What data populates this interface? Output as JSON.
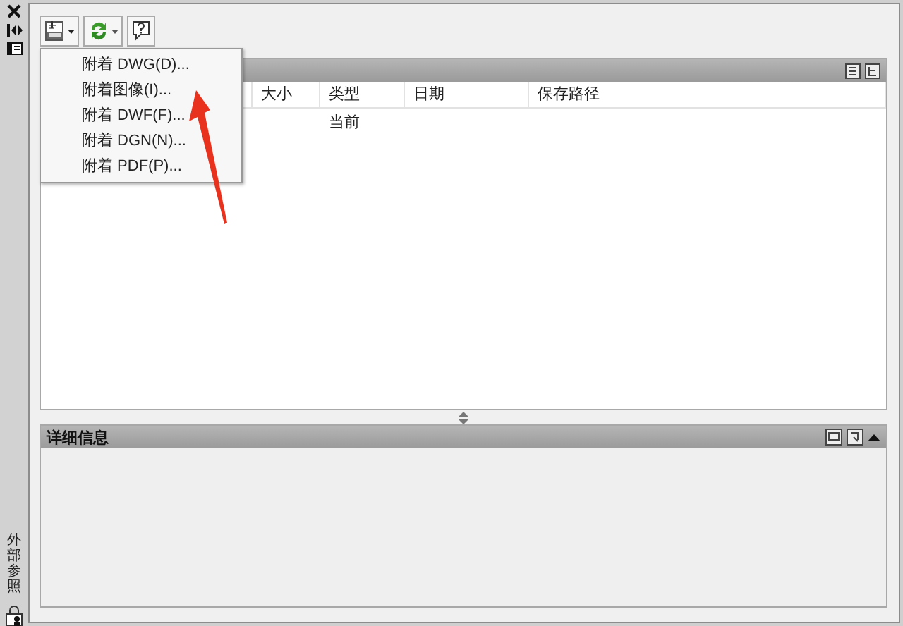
{
  "side_title": "外部参照",
  "attach_menu": {
    "items": [
      "附着 DWG(D)...",
      "附着图像(I)...",
      "附着 DWF(F)...",
      "附着 DGN(N)...",
      "附着 PDF(P)..."
    ]
  },
  "table": {
    "columns": [
      "大小",
      "类型",
      "日期",
      "保存路径"
    ],
    "rows": [
      [
        "",
        "当前",
        "",
        ""
      ]
    ]
  },
  "details": {
    "title": "详细信息"
  }
}
